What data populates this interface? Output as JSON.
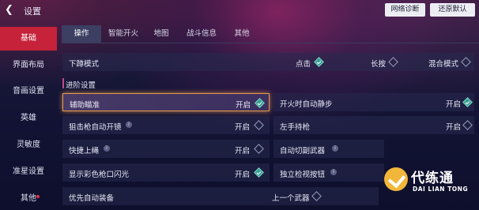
{
  "header": {
    "title": "设置",
    "buttons": {
      "network": "网络诊断",
      "reset": "还原默认"
    }
  },
  "sidebar": {
    "items": [
      {
        "label": "基础",
        "active": true
      },
      {
        "label": "界面布局",
        "active": false
      },
      {
        "label": "音画设置",
        "active": false
      },
      {
        "label": "英雄",
        "active": false
      },
      {
        "label": "灵敏度",
        "active": false
      },
      {
        "label": "准星设置",
        "active": false
      },
      {
        "label": "其他",
        "active": false,
        "badge": true
      }
    ]
  },
  "tabs": [
    {
      "label": "操作",
      "active": true
    },
    {
      "label": "智能开火",
      "active": false
    },
    {
      "label": "地图",
      "active": false
    },
    {
      "label": "战斗信息",
      "active": false
    },
    {
      "label": "其他",
      "active": false
    }
  ],
  "crouch": {
    "label": "下蹲模式",
    "options": [
      {
        "label": "点击",
        "checked": true
      },
      {
        "label": "长按",
        "checked": false
      },
      {
        "label": "混合模式",
        "checked": false
      }
    ]
  },
  "advanced": {
    "title": "进阶设置",
    "left": [
      {
        "label": "辅助瞄准",
        "value": "开启",
        "checked": true,
        "info": false,
        "highlighted": true
      },
      {
        "label": "狙击枪自动开镜",
        "value": "开启",
        "checked": false,
        "info": true
      },
      {
        "label": "快捷上绳",
        "value": "开启",
        "checked": false,
        "info": true
      },
      {
        "label": "显示彩色枪口闪光",
        "value": "开启",
        "checked": true,
        "info": false
      }
    ],
    "right": [
      {
        "label": "开火时自动静步",
        "value": "开启",
        "checked": true,
        "info": false
      },
      {
        "label": "左手持枪",
        "value": "开启",
        "checked": false,
        "info": false
      },
      {
        "label": "自动切副武器",
        "value": "开启",
        "checked": false,
        "info": true
      },
      {
        "label": "独立检视按钮",
        "value": "",
        "checked": false,
        "info": true
      }
    ],
    "bottom": {
      "label": "优先自动装备",
      "value": "上一个武器",
      "checked": false
    }
  },
  "watermark": {
    "name": "代练通",
    "en": "DAI LIAN TONG"
  },
  "colors": {
    "accent": "#c6223a",
    "check_on": "#3aa096",
    "highlight": "#e39a4d"
  },
  "icons": [
    "back-arrow-icon",
    "diamond-check-icon",
    "info-icon"
  ]
}
